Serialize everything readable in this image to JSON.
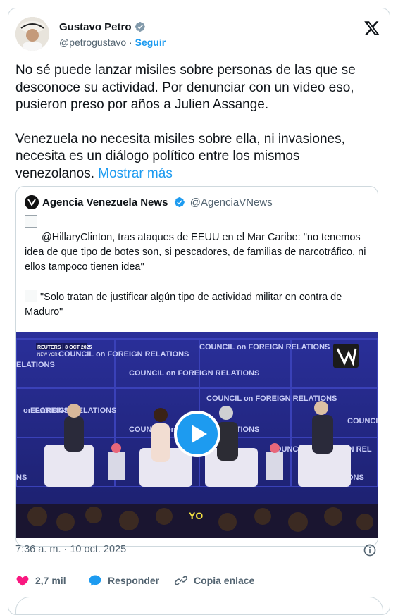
{
  "author": {
    "name": "Gustavo Petro",
    "handle": "@petrogustavo",
    "separator": "·",
    "follow_label": "Seguir"
  },
  "post": {
    "paragraph1": "No sé puede lanzar misiles sobre personas de las que se desconoce su actividad. Por denunciar con un video eso, pusieron preso por años a Julien Assange.",
    "paragraph2": "Venezuela no necesita misiles sobre ella, ni invasiones, necesita es un diálogo político entre los mismos venezolanos.",
    "show_more": "Mostrar más"
  },
  "quote": {
    "name": "Agencia Venezuela News",
    "handle": "@AgenciaVNews",
    "line1": "@HillaryClinton, tras ataques de EEUU en el Mar Caribe: \"no tenemos idea de que tipo de botes son, si pescadores, de familias de narcotráfico, ni ellos tampoco tienen idea\"",
    "line2": "\"Solo tratan de justificar algún tipo de actividad militar en contra de Maduro\""
  },
  "video": {
    "reuters_tag": "REUTERS | 8 OCT 2025",
    "location_tag": "NEW YORK",
    "banner": "COUNCIL on FOREIGN RELATIONS",
    "caption": "YO"
  },
  "meta": {
    "timestamp": "7:36 a. m. · 10 oct. 2025"
  },
  "actions": {
    "likes": "2,7 mil",
    "reply": "Responder",
    "copy_link": "Copia enlace"
  },
  "colors": {
    "accent": "#1d9bf0",
    "like": "#f91880",
    "text": "#0f1419",
    "muted": "#536471",
    "border": "#cfd9de"
  },
  "icons": [
    "verified-badge-icon",
    "x-logo-icon",
    "play-icon",
    "info-icon",
    "heart-icon",
    "reply-bubble-icon",
    "link-icon"
  ]
}
